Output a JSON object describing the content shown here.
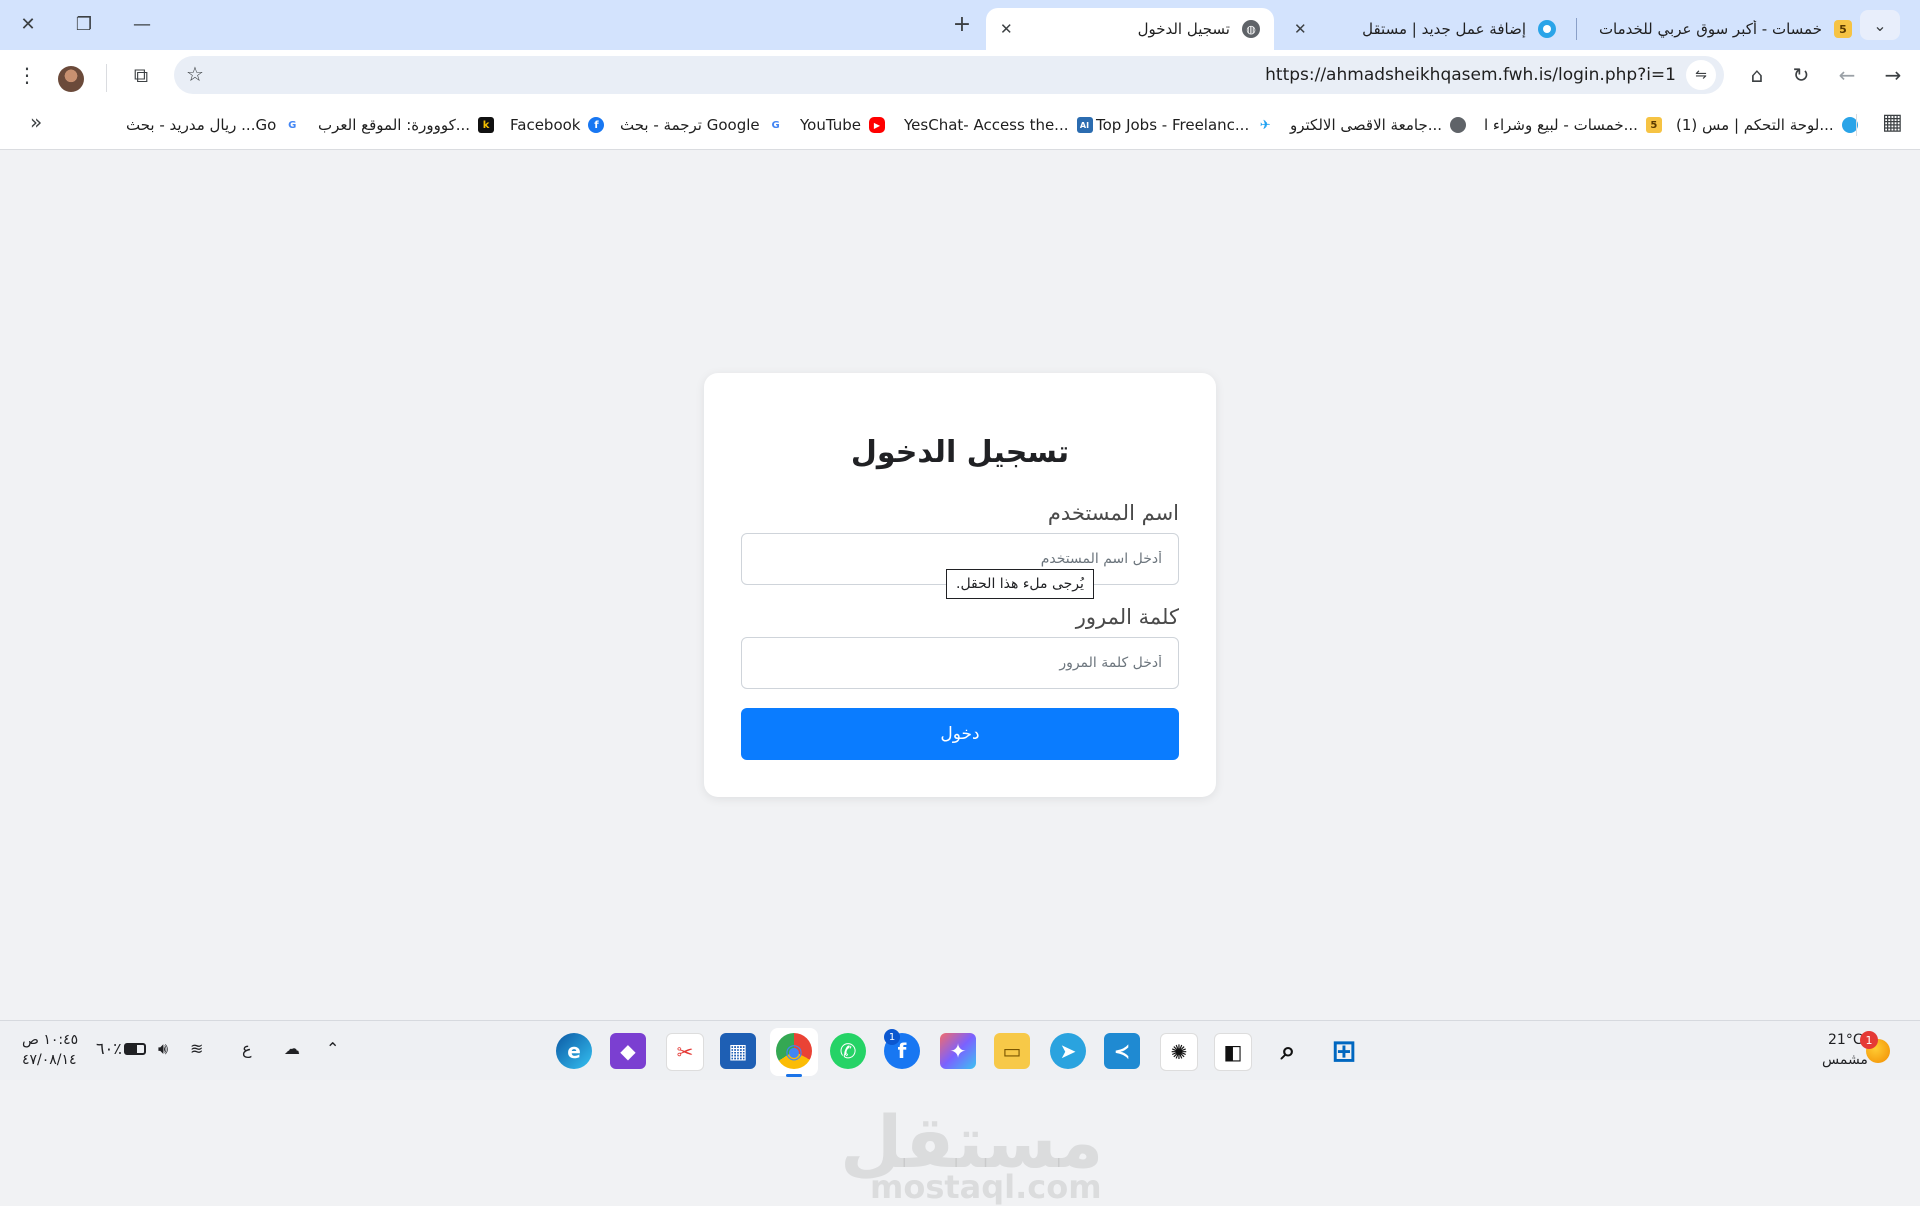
{
  "colors": {
    "accent": "#0a7cff",
    "tab_strip": "#d3e3fd",
    "page_bg": "#f1f2f4"
  },
  "tabs": [
    {
      "title": "خمسات - أكبر سوق عربي للخدمات",
      "icon": "khamsat-favicon",
      "favicon_text": "5"
    },
    {
      "title": "إضافة عمل جديد | مستقل",
      "icon": "mostaql-favicon"
    },
    {
      "title": "تسجيل الدخول",
      "icon": "globe-icon",
      "active": true
    }
  ],
  "window": {
    "close": "✕",
    "maximize": "❐",
    "minimize": "—",
    "new_tab": "+",
    "tab_close": "✕",
    "tab_search": "⌄"
  },
  "toolbar": {
    "url": "https://ahmadsheikhqasem.fwh.is/login.php?i=1",
    "menu": "⋮",
    "extensions": "⧉",
    "star": "☆",
    "tune": "⇋",
    "home": "⌂",
    "reload": "↻",
    "back": "←",
    "forward": "→"
  },
  "bookmarks": {
    "apps_icon": "▦",
    "overflow": "»",
    "items": [
      {
        "label": "(1) لوحة التحكم | مس...",
        "icon": "mostaql-favicon"
      },
      {
        "label": "خمسات - لبيع وشراء ا...",
        "icon": "khamsat-favicon",
        "favicon_text": "5"
      },
      {
        "label": "جامعة الاقصى الالكترو...",
        "icon": "globe-icon"
      },
      {
        "label": "Top Jobs - Freelanc...",
        "icon": "bird-icon",
        "favicon_text": "✈"
      },
      {
        "label": "YesChat- Access the...",
        "icon": "yeschat-favicon",
        "favicon_text": "AI"
      },
      {
        "label": "YouTube",
        "icon": "youtube-icon",
        "favicon_text": "▶"
      },
      {
        "label": "ترجمة - بحث Google",
        "icon": "google-icon",
        "favicon_text": "G"
      },
      {
        "label": "Facebook",
        "icon": "facebook-icon",
        "favicon_text": "f"
      },
      {
        "label": "كووورة: الموقع العرب...",
        "icon": "kooora-favicon",
        "favicon_text": "k"
      },
      {
        "label": "ريال مدريد - بحث ...Go",
        "icon": "google-icon",
        "favicon_text": "G"
      }
    ]
  },
  "login": {
    "title": "تسجيل الدخول",
    "username_label": "اسم المستخدم",
    "username_placeholder": "أدخل اسم المستخدم",
    "password_label": "كلمة المرور",
    "password_placeholder": "أدخل كلمة المرور",
    "submit_label": "دخول",
    "validation_tooltip": ".يُرجى ملء هذا الحقل"
  },
  "watermark": {
    "logo": "مستقل",
    "url": "mostaql.com"
  },
  "taskbar": {
    "time": "١٠:٤٥ ص",
    "date": "٤٧/٠٨/١٤",
    "battery": "٦٠٪",
    "language": "ع",
    "weather_temp": "21°C",
    "weather_condition": "مشمس",
    "weather_badge": "1",
    "facebook_badge": "1",
    "apps": [
      {
        "name": "start-button-icon",
        "glyph": "⊞"
      },
      {
        "name": "search-icon",
        "glyph": "⌕"
      },
      {
        "name": "task-view-icon",
        "glyph": "◧"
      },
      {
        "name": "chatgpt-icon",
        "glyph": "✺"
      },
      {
        "name": "vscode-icon",
        "glyph": "≺"
      },
      {
        "name": "telegram-icon",
        "glyph": "➤"
      },
      {
        "name": "file-explorer-icon",
        "glyph": "▭"
      },
      {
        "name": "copilot-icon",
        "glyph": "✦"
      },
      {
        "name": "facebook-app-icon",
        "glyph": "f"
      },
      {
        "name": "whatsapp-icon",
        "glyph": "✆"
      },
      {
        "name": "chrome-icon",
        "glyph": "◉"
      },
      {
        "name": "microsoft-store-icon",
        "glyph": "▦"
      },
      {
        "name": "snipping-tool-icon",
        "glyph": "✂"
      },
      {
        "name": "visual-studio-icon",
        "glyph": "◆"
      },
      {
        "name": "edge-icon",
        "glyph": "e"
      }
    ]
  }
}
